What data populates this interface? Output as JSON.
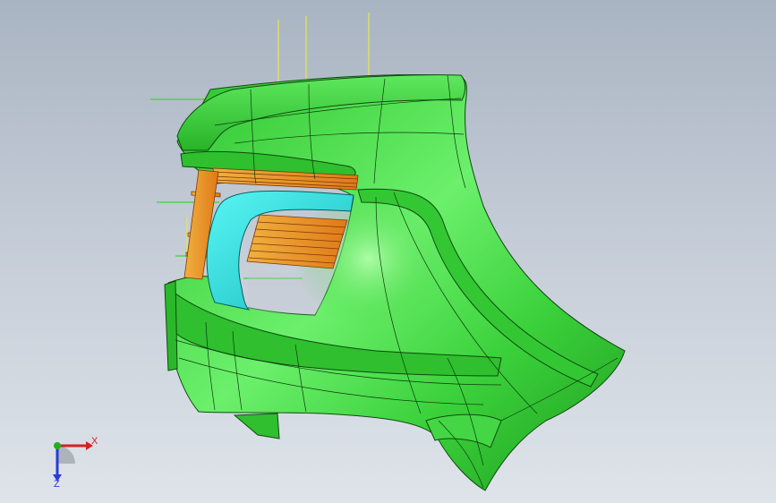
{
  "viewport": {
    "background_top": "#a9b4c2",
    "background_bottom": "#dfe4ea"
  },
  "model": {
    "body_color": "#3bd13b",
    "body_highlight": "#8cf58c",
    "body_shadow": "#1e9c1e",
    "grille_color": "#f59a2a",
    "trim_color": "#22e6e6",
    "annotation_leader_colors": [
      "#e8e84a",
      "#3ad43a"
    ]
  },
  "triad": {
    "x_label": "X",
    "z_label": "Z",
    "x_color": "#d92020",
    "y_color": "#20b020",
    "z_color": "#2a3ad9"
  }
}
